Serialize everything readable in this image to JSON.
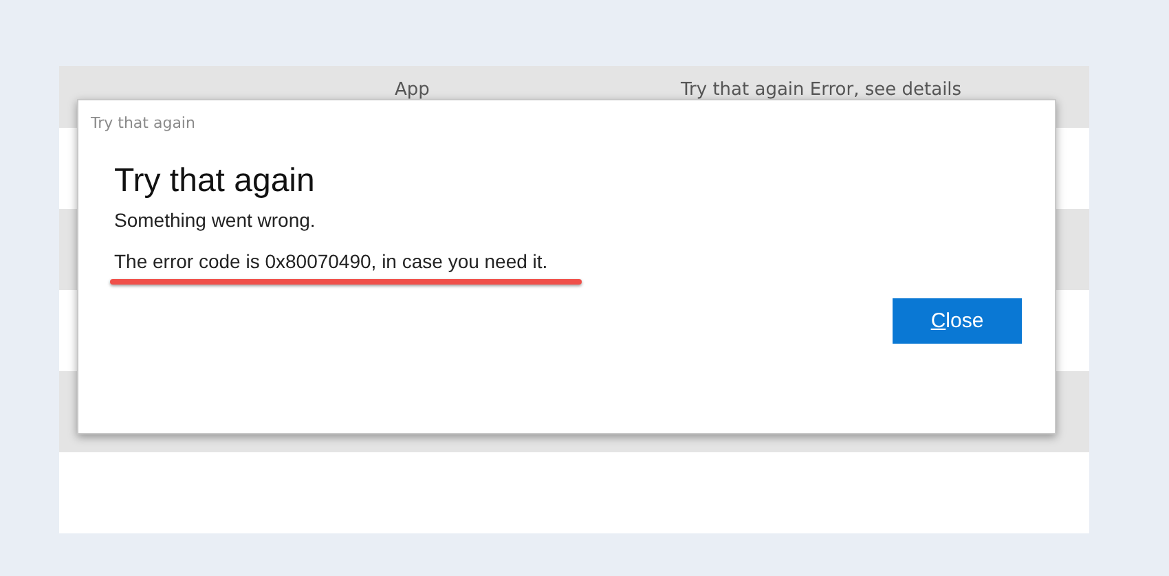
{
  "background_table": {
    "columns": [
      "App",
      "Try that again Error, see details"
    ]
  },
  "dialog": {
    "title": "Try that again",
    "heading": "Try that again",
    "message": "Something went wrong.",
    "detail": "The error code is 0x80070490, in case you need it.",
    "detail_underlined": true,
    "button": {
      "label": "Close",
      "access_key_underlined": true
    }
  }
}
